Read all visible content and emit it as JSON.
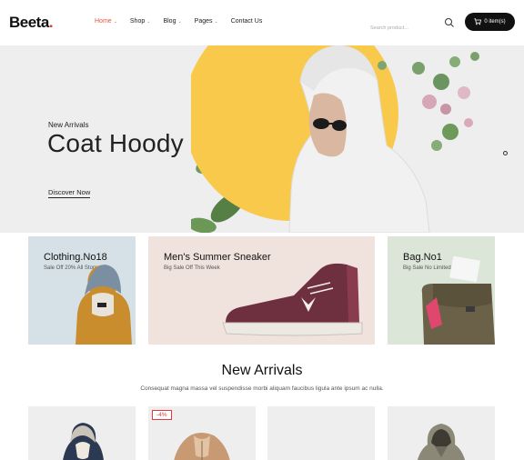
{
  "brand": {
    "name": "Beeta",
    "dot": ".",
    "accent": "#e53935"
  },
  "nav": {
    "items": [
      {
        "label": "Home",
        "has_caret": true,
        "active": true
      },
      {
        "label": "Shop",
        "has_caret": true
      },
      {
        "label": "Blog",
        "has_caret": true
      },
      {
        "label": "Pages",
        "has_caret": true
      },
      {
        "label": "Contact Us",
        "has_caret": false
      }
    ],
    "caret": "⌄"
  },
  "search": {
    "placeholder": "Search product..."
  },
  "cart": {
    "label": "0 item(s)"
  },
  "hero": {
    "subtitle": "New Arrivals",
    "title": "Coat Hoody",
    "cta": "Discover Now",
    "circle_color": "#f9c94b"
  },
  "banners": [
    {
      "title": "Clothing.No18",
      "subtitle": "Sale Off 20% All Store"
    },
    {
      "title": "Men's Summer Sneaker",
      "subtitle": "Big Sale Off This Week"
    },
    {
      "title": "Bag.No1",
      "subtitle": "Big Sale No Limited"
    }
  ],
  "new_arrivals": {
    "title": "New Arrivals",
    "description": "Consequat magna massa vel suspendisse morbi aliquam faucibus ligula ante ipsum ac nulla.",
    "products": [
      {
        "badge": ""
      },
      {
        "badge": "-4%"
      },
      {
        "badge": ""
      },
      {
        "badge": ""
      }
    ]
  }
}
